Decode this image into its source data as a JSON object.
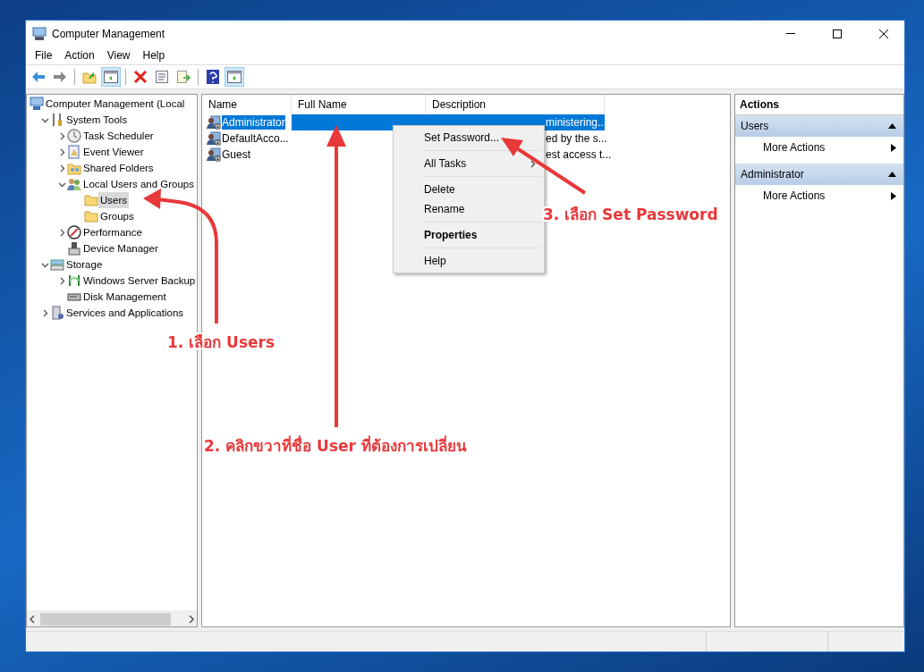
{
  "window": {
    "title": "Computer Management"
  },
  "menu_bar": [
    "File",
    "Action",
    "View",
    "Help"
  ],
  "toolbar": [
    {
      "kind": "back",
      "on": false
    },
    {
      "kind": "forward",
      "on": false
    },
    {
      "kind": "sep"
    },
    {
      "kind": "up",
      "on": false
    },
    {
      "kind": "tree",
      "on": true
    },
    {
      "kind": "sep"
    },
    {
      "kind": "delete",
      "on": false
    },
    {
      "kind": "properties",
      "on": false
    },
    {
      "kind": "export",
      "on": false
    },
    {
      "kind": "sep"
    },
    {
      "kind": "help",
      "on": false
    },
    {
      "kind": "actionpane",
      "on": true
    }
  ],
  "tree": [
    {
      "label": "Computer Management (Local",
      "kind": "computer",
      "selected": false,
      "children": [
        {
          "label": "System Tools",
          "kind": "tools",
          "expanded": true,
          "selected": false,
          "children": [
            {
              "label": "Task Scheduler",
              "kind": "clock",
              "expanded": false,
              "selected": false
            },
            {
              "label": "Event Viewer",
              "kind": "log",
              "expanded": false,
              "selected": false
            },
            {
              "label": "Shared Folders",
              "kind": "share",
              "expanded": false,
              "selected": false
            },
            {
              "label": "Local Users and Groups",
              "kind": "users",
              "expanded": true,
              "selected": false,
              "children": [
                {
                  "label": "Users",
                  "kind": "folder",
                  "selected": true
                },
                {
                  "label": "Groups",
                  "kind": "folder",
                  "selected": false
                }
              ]
            },
            {
              "label": "Performance",
              "kind": "perf",
              "expanded": false,
              "selected": false
            },
            {
              "label": "Device Manager",
              "kind": "device",
              "selected": false
            }
          ]
        },
        {
          "label": "Storage",
          "kind": "storage",
          "expanded": true,
          "selected": false,
          "children": [
            {
              "label": "Windows Server Backup",
              "kind": "backup",
              "expanded": false,
              "selected": false
            },
            {
              "label": "Disk Management",
              "kind": "disk",
              "selected": false
            }
          ]
        },
        {
          "label": "Services and Applications",
          "kind": "services",
          "expanded": false,
          "selected": false
        }
      ]
    }
  ],
  "list": {
    "columns": [
      "Name",
      "Full Name",
      "Description"
    ],
    "rows": [
      {
        "name": "Administrator",
        "full_name": "",
        "description": "ministering...",
        "selected": true
      },
      {
        "name": "DefaultAcco...",
        "full_name": "",
        "description": "ed by the s...",
        "selected": false
      },
      {
        "name": "Guest",
        "full_name": "",
        "description": "est access t...",
        "selected": false
      }
    ]
  },
  "context_menu": [
    {
      "kind": "item",
      "label": "Set Password...",
      "default": false,
      "submenu": false
    },
    {
      "kind": "sep"
    },
    {
      "kind": "item",
      "label": "All Tasks",
      "default": false,
      "submenu": true
    },
    {
      "kind": "sep"
    },
    {
      "kind": "item",
      "label": "Delete",
      "default": false,
      "submenu": false
    },
    {
      "kind": "item",
      "label": "Rename",
      "default": false,
      "submenu": false
    },
    {
      "kind": "sep"
    },
    {
      "kind": "item",
      "label": "Properties",
      "default": true,
      "submenu": false
    },
    {
      "kind": "sep"
    },
    {
      "kind": "item",
      "label": "Help",
      "default": false,
      "submenu": false
    }
  ],
  "actions": {
    "title": "Actions",
    "sections": [
      {
        "title": "Users",
        "expanded": true,
        "items": [
          "More Actions"
        ]
      },
      {
        "title": "Administrator",
        "expanded": true,
        "items": [
          "More Actions"
        ]
      }
    ]
  },
  "annotations": [
    {
      "text": "1. เลือก Users",
      "kind": "curved"
    },
    {
      "text": "2. คลิกขวาที่ชื่อ User ที่ต้องการเปลี่ยน",
      "kind": "vertical"
    },
    {
      "text": "3. เลือก Set Password",
      "kind": "diagonal"
    }
  ]
}
